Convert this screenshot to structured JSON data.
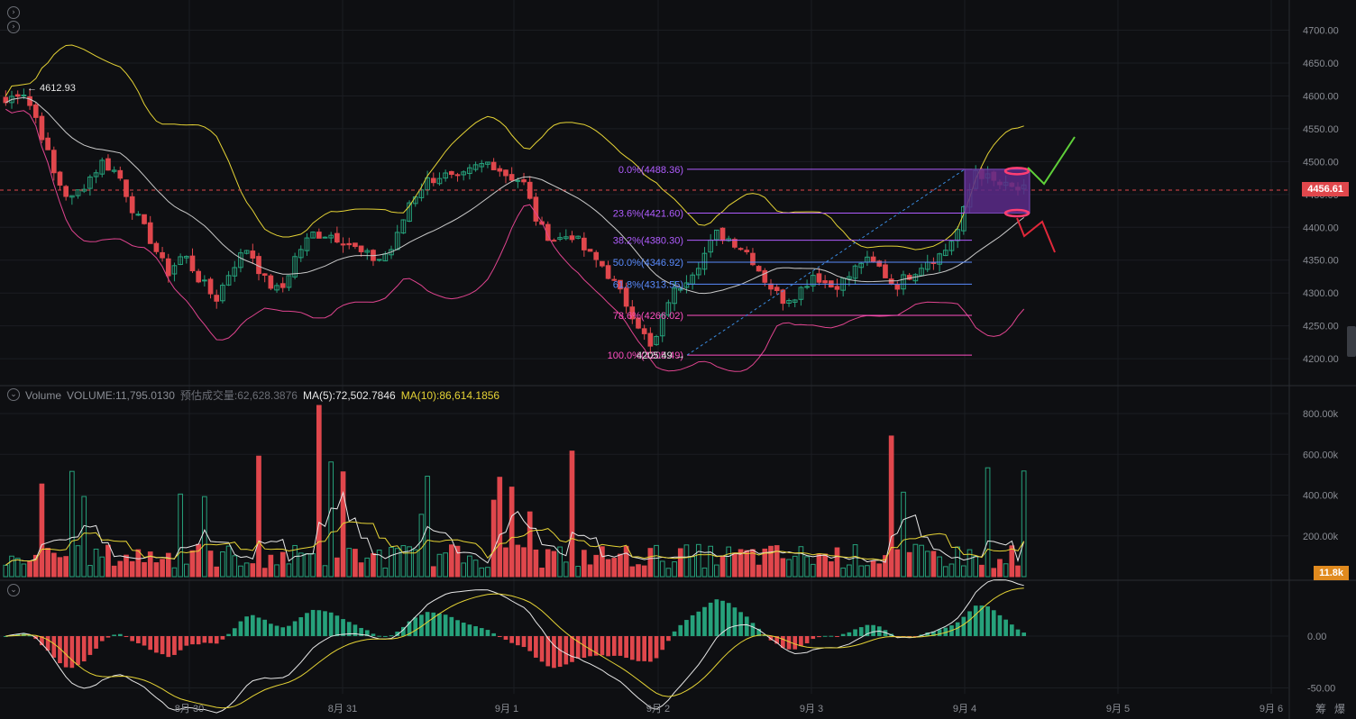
{
  "chart_data": {
    "type": "candlestick",
    "x_ticks": [
      "8月 30",
      "8月 31",
      "9月 1",
      "9月 2",
      "9月 3",
      "9月 4",
      "9月 5",
      "9月 6"
    ],
    "price_axis": {
      "range": [
        4170,
        4735
      ],
      "ticks": [
        "4700.00",
        "4650.00",
        "4600.00",
        "4550.00",
        "4500.00",
        "4450.00",
        "4400.00",
        "4350.00",
        "4300.00",
        "4250.00",
        "4200.00"
      ]
    },
    "current_price": "4456.61",
    "high_label": "4612.93",
    "low_label": "4205.49",
    "fibonacci": [
      {
        "label": "0.0%(4488.36)",
        "price": 4488.36,
        "color": "#b05cff"
      },
      {
        "label": "23.6%(4421.60)",
        "price": 4421.6,
        "color": "#b05cff"
      },
      {
        "label": "38.2%(4380.30)",
        "price": 4380.3,
        "color": "#b05cff"
      },
      {
        "label": "50.0%(4346.92)",
        "price": 4346.92,
        "color": "#5a8cff"
      },
      {
        "label": "61.8%(4313.55)",
        "price": 4313.55,
        "color": "#5a8cff"
      },
      {
        "label": "78.6%(4266.02)",
        "price": 4266.02,
        "color": "#ff4fc2"
      },
      {
        "label": "100.0%(4205.49)",
        "price": 4205.49,
        "color": "#ff4fc2"
      }
    ],
    "candles_anchor_prices": [
      4590,
      4612,
      4560,
      4480,
      4440,
      4470,
      4500,
      4480,
      4420,
      4380,
      4330,
      4360,
      4320,
      4290,
      4340,
      4370,
      4320,
      4300,
      4360,
      4390,
      4390,
      4380,
      4360,
      4350,
      4370,
      4440,
      4470,
      4480,
      4470,
      4490,
      4500,
      4480,
      4470,
      4400,
      4380,
      4390,
      4360,
      4340,
      4300,
      4260,
      4210,
      4290,
      4320,
      4350,
      4390,
      4380,
      4360,
      4320,
      4290,
      4300,
      4330,
      4310,
      4320,
      4350,
      4340,
      4310,
      4330,
      4350,
      4360,
      4400,
      4488,
      4470,
      4460,
      4456
    ],
    "volume_axis": {
      "ticks": [
        "800.00k",
        "600.00k",
        "400.00k",
        "200.00k"
      ],
      "max": 840
    },
    "volume_badge": "11.8k",
    "volume_legend": {
      "title": "Volume",
      "volume": "VOLUME:11,795.0130",
      "est": "预估成交量:62,628.3876",
      "ma5": "MA(5):72,502.7846",
      "ma10": "MA(10):86,614.1856"
    },
    "macd_axis": {
      "ticks": [
        "0.00",
        "-50.00"
      ]
    },
    "colors": {
      "up": "#26a17b",
      "down": "#e0474c",
      "mid_band": "#c9c9c9",
      "upper_band": "#e5d335",
      "lower_band": "#e0448f",
      "current": "#e0474c",
      "volume_badge": "#e08a1e",
      "projection_up": "#5fd03a",
      "projection_down": "#e0283a",
      "fib_box": "#5a2a8a"
    },
    "corner_labels": [
      "筹",
      "爆"
    ]
  }
}
